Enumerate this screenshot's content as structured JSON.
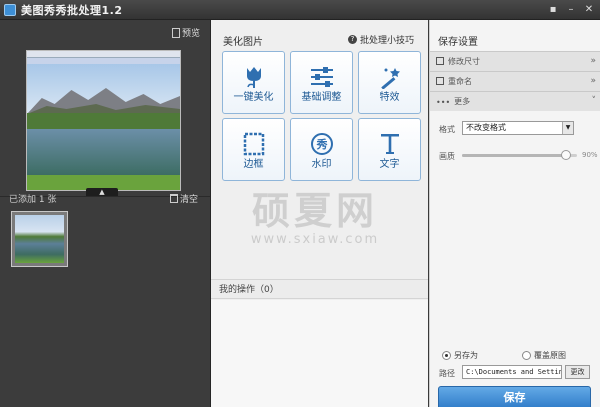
{
  "window": {
    "title": "美图秀秀批处理1.2"
  },
  "left_panel": {
    "preview_label": "预览",
    "added_label": "已添加 1 张",
    "clear_label": "清空"
  },
  "middle_panel": {
    "title": "美化图片",
    "tips_label": "批处理小技巧",
    "tools": [
      {
        "label": "一键美化",
        "icon": "tulip-icon"
      },
      {
        "label": "基础调整",
        "icon": "sliders-icon"
      },
      {
        "label": "特效",
        "icon": "magic-wand-icon"
      },
      {
        "label": "边框",
        "icon": "frame-icon"
      },
      {
        "label": "水印",
        "icon": "stamp-icon"
      },
      {
        "label": "文字",
        "icon": "text-icon"
      }
    ],
    "operations_label": "我的操作（0）"
  },
  "watermark": {
    "text": "硕夏网",
    "url": "www.sxiaw.com"
  },
  "right_panel": {
    "title": "保存设置",
    "sections": [
      {
        "label": "修改尺寸",
        "chevron": "»"
      },
      {
        "label": "重命名",
        "chevron": "»"
      },
      {
        "label": "更多",
        "chevron": "˅"
      }
    ],
    "format_label": "格式",
    "format_value": "不改变格式",
    "quality_label": "画质",
    "quality_value": "90%",
    "quality_level": 0.9,
    "save_as_label": "另存为",
    "overwrite_label": "覆盖原图",
    "path_label": "路径",
    "path_value": "C:\\Documents and Settings\\",
    "browse_label": "更改",
    "save_label": "保存"
  }
}
